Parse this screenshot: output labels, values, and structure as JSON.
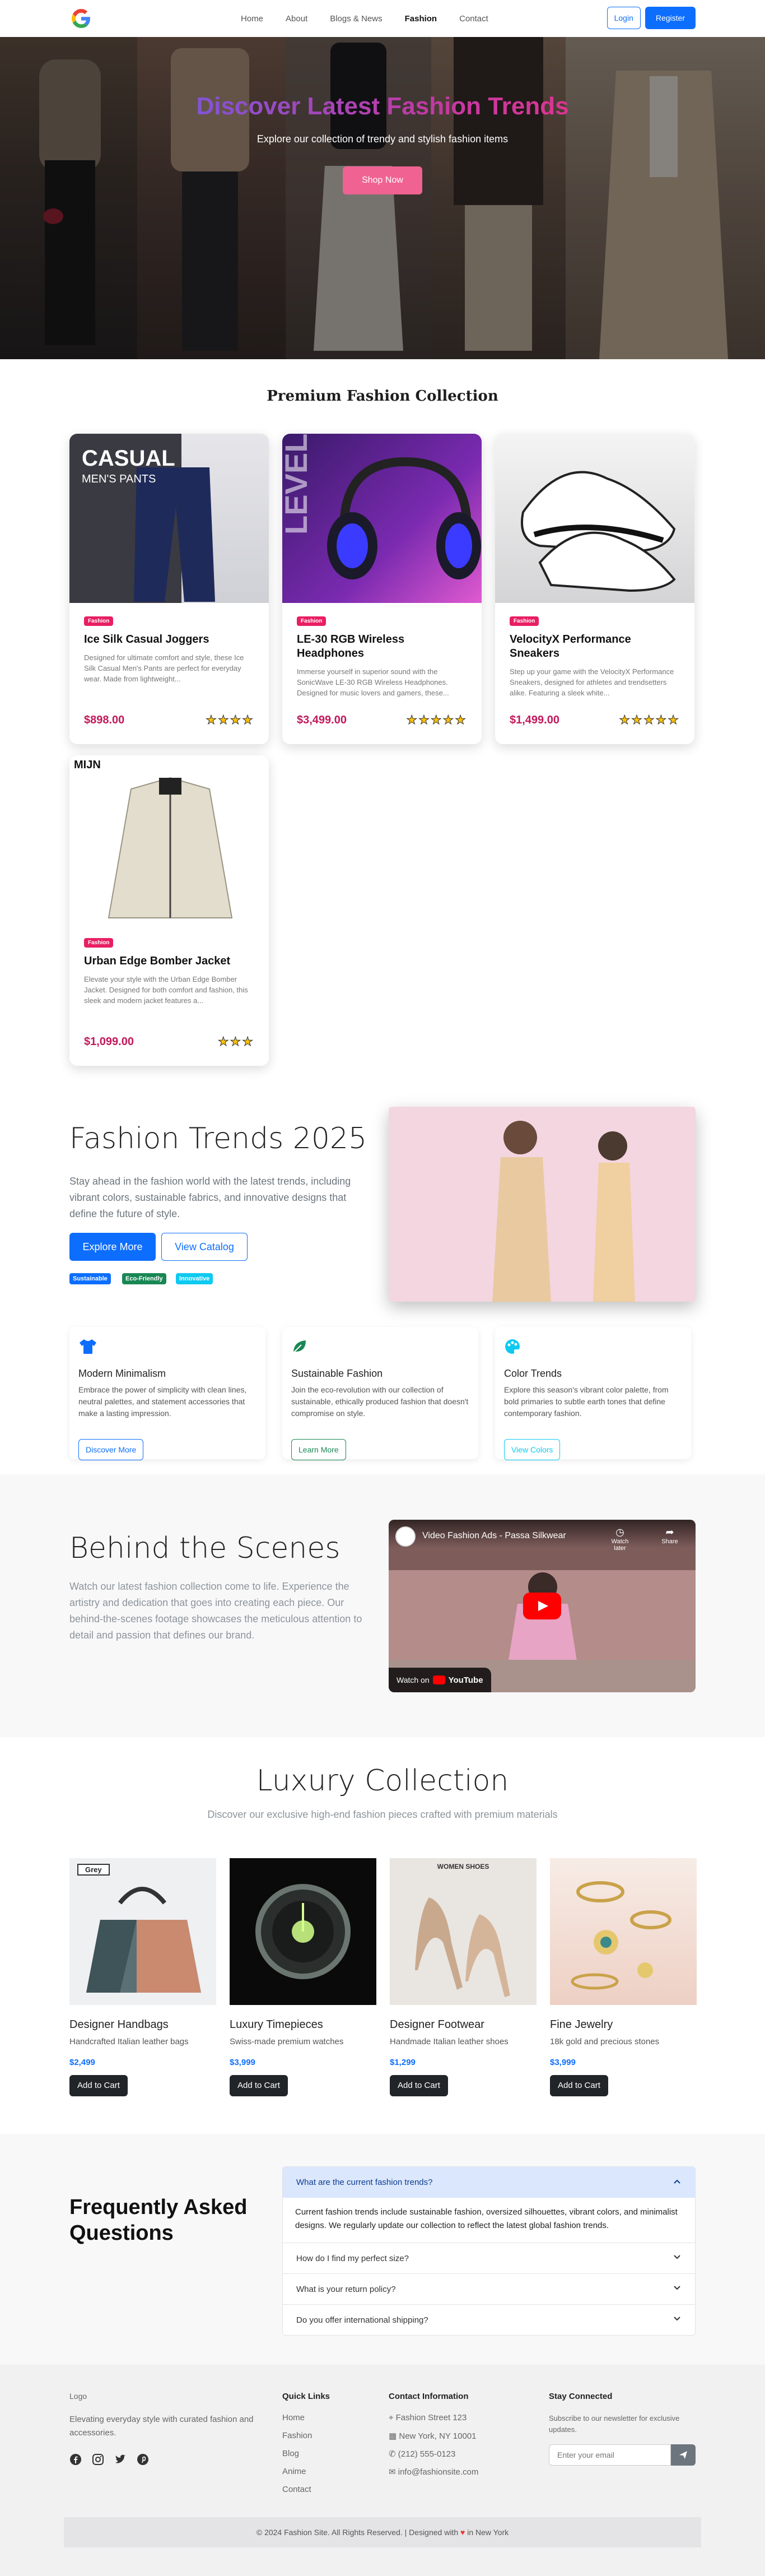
{
  "nav": {
    "links": [
      "Home",
      "About",
      "Blogs & News",
      "Fashion",
      "Contact"
    ],
    "login": "Login",
    "register": "Register"
  },
  "hero": {
    "title": "Discover Latest Fashion Trends",
    "subtitle": "Explore our collection of trendy and stylish fashion items",
    "button": "Shop Now"
  },
  "premium": {
    "title": "Premium Fashion Collection",
    "products": [
      {
        "badge": "Fashion",
        "name": "Ice Silk Casual Joggers",
        "desc": "Designed for ultimate comfort and style, these Ice Silk Casual Men's Pants are perfect for everyday wear. Made from lightweight...",
        "price": "$898.00",
        "stars": "★★★★",
        "img_text_1": "CASUAL",
        "img_text_2": "MEN'S PANTS"
      },
      {
        "badge": "Fashion",
        "name": "LE-30 RGB Wireless Headphones",
        "desc": "Immerse yourself in superior sound with the SonicWave LE-30 RGB Wireless Headphones. Designed for music lovers and gamers, these...",
        "price": "$3,499.00",
        "stars": "★★★★★",
        "img_text_1": "LEVEL"
      },
      {
        "badge": "Fashion",
        "name": "VelocityX Performance Sneakers",
        "desc": "Step up your game with the VelocityX Performance Sneakers, designed for athletes and trendsetters alike. Featuring a sleek white...",
        "price": "$1,499.00",
        "stars": "★★★★★"
      },
      {
        "badge": "Fashion",
        "name": "Urban Edge Bomber Jacket",
        "desc": "Elevate your style with the Urban Edge Bomber Jacket. Designed for both comfort and fashion, this sleek and modern jacket features a...",
        "price": "$1,099.00",
        "stars": "★★★",
        "img_text_1": "MIJN"
      }
    ]
  },
  "trends": {
    "title": "Fashion Trends 2025",
    "text": "Stay ahead in the fashion world with the latest trends, including vibrant colors, sustainable fabrics, and innovative designs that define the future of style.",
    "btn_primary": "Explore More",
    "btn_secondary": "View Catalog",
    "tags": [
      "Sustainable",
      "Eco-Friendly",
      "Innovative"
    ],
    "features": [
      {
        "title": "Modern Minimalism",
        "text": "Embrace the power of simplicity with clean lines, neutral palettes, and statement accessories that make a lasting impression.",
        "button": "Discover More",
        "icon": "tshirt-icon"
      },
      {
        "title": "Sustainable Fashion",
        "text": "Join the eco-revolution with our collection of sustainable, ethically produced fashion that doesn't compromise on style.",
        "button": "Learn More",
        "icon": "leaf-icon"
      },
      {
        "title": "Color Trends",
        "text": "Explore this season's vibrant color palette, from bold primaries to subtle earth tones that define contemporary fashion.",
        "button": "View Colors",
        "icon": "palette-icon"
      }
    ]
  },
  "behind": {
    "title": "Behind the Scenes",
    "text": "Watch our latest fashion collection come to life. Experience the artistry and dedication that goes into creating each piece. Our behind-the-scenes footage showcases the meticulous attention to detail and passion that defines our brand.",
    "video_title": "Video Fashion Ads - Passa Silkwear",
    "watch_later": "Watch later",
    "share": "Share",
    "watch_on": "Watch on",
    "youtube": "YouTube"
  },
  "luxury": {
    "title": "Luxury Collection",
    "subtitle": "Discover our exclusive high-end fashion pieces crafted with premium materials",
    "items": [
      {
        "name": "Designer Handbags",
        "desc": "Handcrafted Italian leather bags",
        "price": "$2,499",
        "button": "Add to Cart",
        "img_label": "Grey"
      },
      {
        "name": "Luxury Timepieces",
        "desc": "Swiss-made premium watches",
        "price": "$3,999",
        "button": "Add to Cart"
      },
      {
        "name": "Designer Footwear",
        "desc": "Handmade Italian leather shoes",
        "price": "$1,299",
        "button": "Add to Cart",
        "img_label": "WOMEN SHOES"
      },
      {
        "name": "Fine Jewelry",
        "desc": "18k gold and precious stones",
        "price": "$3,999",
        "button": "Add to Cart"
      }
    ]
  },
  "faq": {
    "title": "Frequently Asked Questions",
    "items": [
      {
        "q": "What are the current fashion trends?",
        "a": "Current fashion trends include sustainable fashion, oversized silhouettes, vibrant colors, and minimalist designs. We regularly update our collection to reflect the latest global fashion trends."
      },
      {
        "q": "How do I find my perfect size?"
      },
      {
        "q": "What is your return policy?"
      },
      {
        "q": "Do you offer international shipping?"
      }
    ]
  },
  "footer": {
    "logo_alt": "Logo",
    "tagline": "Elevating everyday style with curated fashion and accessories.",
    "quick_title": "Quick Links",
    "quick_links": [
      "Home",
      "Fashion",
      "Blog",
      "Anime",
      "Contact"
    ],
    "contact_title": "Contact Information",
    "contact": [
      "Fashion Street 123",
      "New York, NY 10001",
      "(212) 555-0123",
      "info@fashionsite.com"
    ],
    "stay_title": "Stay Connected",
    "stay_text": "Subscribe to our newsletter for exclusive updates.",
    "email_placeholder": "Enter your email",
    "copyright_pre": "© 2024 Fashion Site. All Rights Reserved. | Designed with",
    "copyright_post": "in New York"
  },
  "colors": {
    "primary": "#0d6efd",
    "pink": "#f06292",
    "badge": "#e91e63",
    "price": "#c2185b",
    "heart": "#e53935"
  }
}
